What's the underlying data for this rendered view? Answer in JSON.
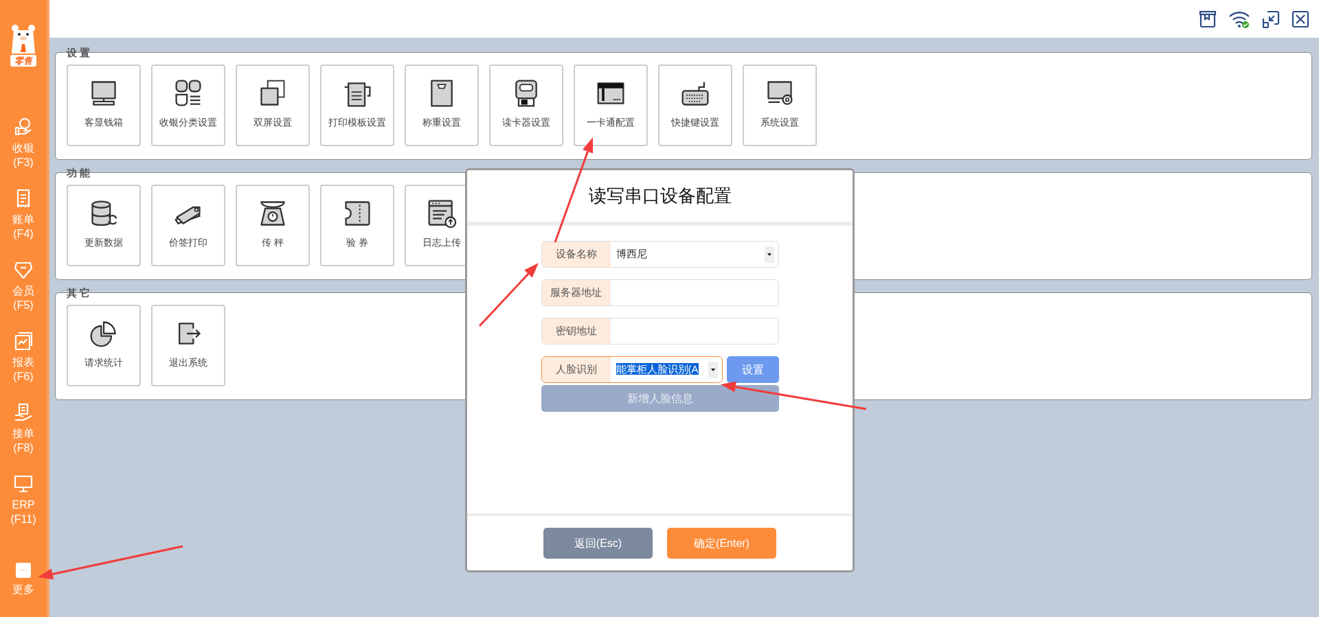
{
  "sidebar": {
    "logo_text": "零售",
    "items": [
      {
        "kind": "coin-hand",
        "label": "收银",
        "shortcut": "(F3)"
      },
      {
        "kind": "receipt",
        "label": "账单",
        "shortcut": "(F4)"
      },
      {
        "kind": "shield",
        "label": "会员",
        "shortcut": "(F5)"
      },
      {
        "kind": "chart",
        "label": "报表",
        "shortcut": "(F6)"
      },
      {
        "kind": "hand-document",
        "label": "接单",
        "shortcut": "(F8)"
      },
      {
        "kind": "monitor",
        "label": "ERP",
        "shortcut": "(F11)"
      }
    ],
    "more": {
      "icon": "···",
      "label": "更多"
    }
  },
  "sections": [
    {
      "title": "设 置",
      "tiles": [
        {
          "kind": "monitor",
          "label": "客显钱箱"
        },
        {
          "kind": "grid",
          "label": "收银分类设置"
        },
        {
          "kind": "squares",
          "label": "双屏设置"
        },
        {
          "kind": "printer",
          "label": "打印模板设置"
        },
        {
          "kind": "scale-box",
          "label": "称重设置"
        },
        {
          "kind": "card-reader",
          "label": "读卡器设置"
        },
        {
          "kind": "card",
          "label": "一卡通配置"
        },
        {
          "kind": "keyboard",
          "label": "快捷键设置"
        },
        {
          "kind": "monitor-gear",
          "label": "系统设置"
        }
      ]
    },
    {
      "title": "功 能",
      "tiles": [
        {
          "kind": "database",
          "label": "更新数据"
        },
        {
          "kind": "tag",
          "label": "价签打印"
        },
        {
          "kind": "scale",
          "label": "传 秤"
        },
        {
          "kind": "ticket",
          "label": "验 券"
        },
        {
          "kind": "upload",
          "label": "日志上传"
        }
      ]
    },
    {
      "title": "其 它",
      "tiles": [
        {
          "kind": "pie-chart",
          "label": "请求统计"
        },
        {
          "kind": "exit",
          "label": "退出系统"
        }
      ]
    }
  ],
  "dialog": {
    "title": "读写串口设备配置",
    "fields": [
      {
        "kind": "select",
        "label": "设备名称",
        "value": "博西尼",
        "focused": false,
        "highlighted": false
      },
      {
        "kind": "text",
        "label": "服务器地址",
        "focused": false
      },
      {
        "kind": "text",
        "label": "密钥地址",
        "focused": false
      },
      {
        "kind": "select",
        "label": "人脸识别",
        "value": "能掌柜人脸识别(A",
        "focused": true,
        "highlighted": true,
        "button": "设置"
      }
    ],
    "add_button": {
      "label": "新增人脸信息",
      "disabled": true
    },
    "buttons": [
      {
        "kind": "cancel",
        "label": "返回(Esc)"
      },
      {
        "kind": "confirm",
        "label": "确定(Enter)"
      }
    ]
  }
}
